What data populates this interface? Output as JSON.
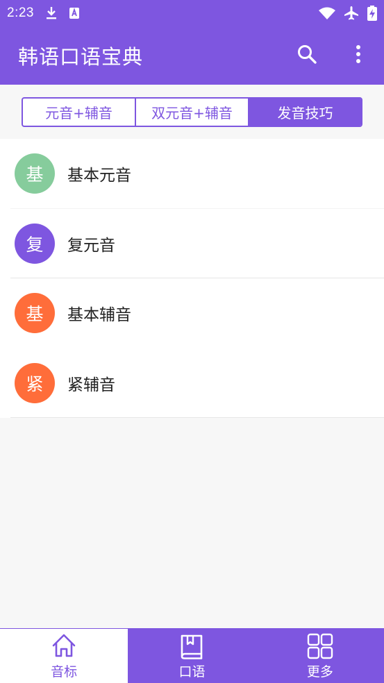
{
  "status_bar": {
    "time": "2:23"
  },
  "app_bar": {
    "title": "韩语口语宝典"
  },
  "segments": [
    {
      "label": "元音+辅音",
      "active": false
    },
    {
      "label": "双元音+辅音",
      "active": false
    },
    {
      "label": "发音技巧",
      "active": true
    }
  ],
  "list": [
    {
      "icon_char": "基",
      "label": "基本元音",
      "color": "#86cc9c"
    },
    {
      "icon_char": "复",
      "label": "复元音",
      "color": "#7e56e0"
    },
    {
      "icon_char": "基",
      "label": "基本辅音",
      "color": "#ff6d3a"
    },
    {
      "icon_char": "紧",
      "label": "紧辅音",
      "color": "#ff6d3a"
    }
  ],
  "bottom_nav": [
    {
      "label": "音标",
      "icon": "home-icon",
      "active": true
    },
    {
      "label": "口语",
      "icon": "book-icon",
      "active": false
    },
    {
      "label": "更多",
      "icon": "grid-icon",
      "active": false
    }
  ],
  "colors": {
    "primary": "#7e56e0"
  }
}
